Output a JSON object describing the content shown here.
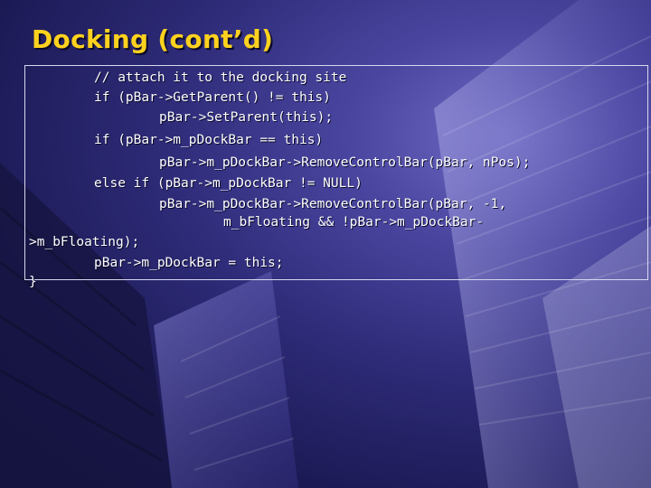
{
  "slide": {
    "title": "Docking (cont’d)",
    "colors": {
      "title": "#ffd21e",
      "text": "#ffffff",
      "background": "#2e2b78"
    },
    "code_lines": [
      "// attach it to the docking site",
      "if (pBar->GetParent() != this)",
      "pBar->SetParent(this);",
      "if (pBar->m_pDockBar == this)",
      "pBar->m_pDockBar->RemoveControlBar(pBar, nPos);",
      "else if (pBar->m_pDockBar != NULL)",
      "pBar->m_pDockBar->RemoveControlBar(pBar, -1,",
      "m_bFloating && !pBar->m_pDockBar-",
      ">m_bFloating);",
      "pBar->m_pDockBar = this;",
      "}"
    ]
  }
}
